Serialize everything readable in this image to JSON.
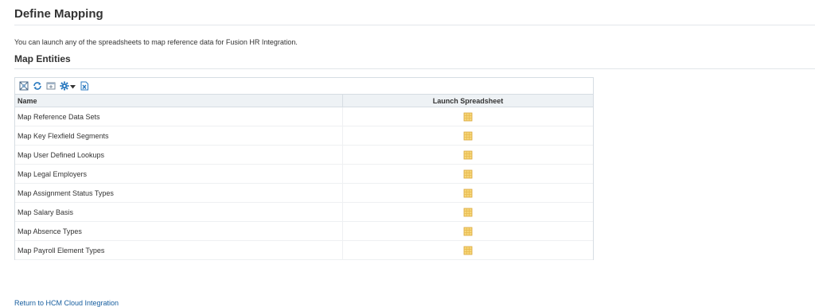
{
  "header": {
    "title": "Define Mapping"
  },
  "intro_text": "You can launch any of the spreadsheets to map reference data for Fusion HR Integration.",
  "section": {
    "title": "Map Entities"
  },
  "toolbar": {
    "icons": [
      "detach-icon",
      "refresh-icon",
      "freeze-icon",
      "view-menu-icon",
      "export-to-excel-icon"
    ]
  },
  "table": {
    "columns": [
      "Name",
      "Launch Spreadsheet"
    ],
    "rows": [
      {
        "name": "Map Reference Data Sets",
        "icon": "spreadsheet-icon"
      },
      {
        "name": "Map Key Flexfield Segments",
        "icon": "spreadsheet-icon"
      },
      {
        "name": "Map User Defined Lookups",
        "icon": "spreadsheet-icon"
      },
      {
        "name": "Map Legal Employers",
        "icon": "spreadsheet-icon"
      },
      {
        "name": "Map Assignment Status Types",
        "icon": "spreadsheet-icon"
      },
      {
        "name": "Map Salary Basis",
        "icon": "spreadsheet-icon"
      },
      {
        "name": "Map Absence Types",
        "icon": "spreadsheet-icon"
      },
      {
        "name": "Map Payroll Element Types",
        "icon": "spreadsheet-icon"
      }
    ]
  },
  "footer": {
    "return_link": "Return to HCM Cloud Integration"
  },
  "colors": {
    "link": "#145c9e",
    "header_bg": "#eef2f5",
    "border": "#d6dde3",
    "sheet_icon": "#f0c24a"
  }
}
